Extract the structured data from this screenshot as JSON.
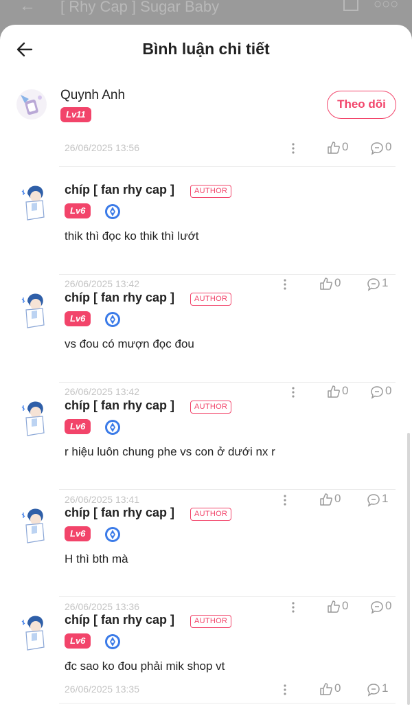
{
  "background": {
    "title": "[ Rhy Cap ] Sugar Baby"
  },
  "header": {
    "title": "Bình luận chi tiết"
  },
  "quoted": {
    "name": "Quynh Anh",
    "level": "Lv11",
    "follow_label": "Theo dõi",
    "date": "26/06/2025 13:56",
    "likes": "0",
    "replies": "0"
  },
  "comments": [
    {
      "name": "chíp [ fan rhy cap ]",
      "tag": "AUTHOR",
      "level": "Lv6",
      "text": "thik thì đọc ko thik thì lướt",
      "date": "26/06/2025 13:42",
      "likes": "0",
      "replies": "1"
    },
    {
      "name": "chíp [ fan rhy cap ]",
      "tag": "AUTHOR",
      "level": "Lv6",
      "text": "vs đou có mượn đọc đou",
      "date": "26/06/2025 13:42",
      "likes": "0",
      "replies": "0"
    },
    {
      "name": "chíp [ fan rhy cap ]",
      "tag": "AUTHOR",
      "level": "Lv6",
      "text": "r hiệu luôn chung phe vs con ở dưới nx r",
      "date": "26/06/2025 13:41",
      "likes": "0",
      "replies": "1"
    },
    {
      "name": "chíp [ fan rhy cap ]",
      "tag": "AUTHOR",
      "level": "Lv6",
      "text": "H thì bth mà",
      "date": "26/06/2025 13:36",
      "likes": "0",
      "replies": "0"
    },
    {
      "name": "chíp [ fan rhy cap ]",
      "tag": "AUTHOR",
      "level": "Lv6",
      "text": "đc sao ko đou phải mik shop vt",
      "date": "26/06/2025 13:35",
      "likes": "0",
      "replies": "1"
    }
  ],
  "colors": {
    "accent": "#f2446a",
    "verified": "#3b7be8",
    "muted": "#999999"
  }
}
